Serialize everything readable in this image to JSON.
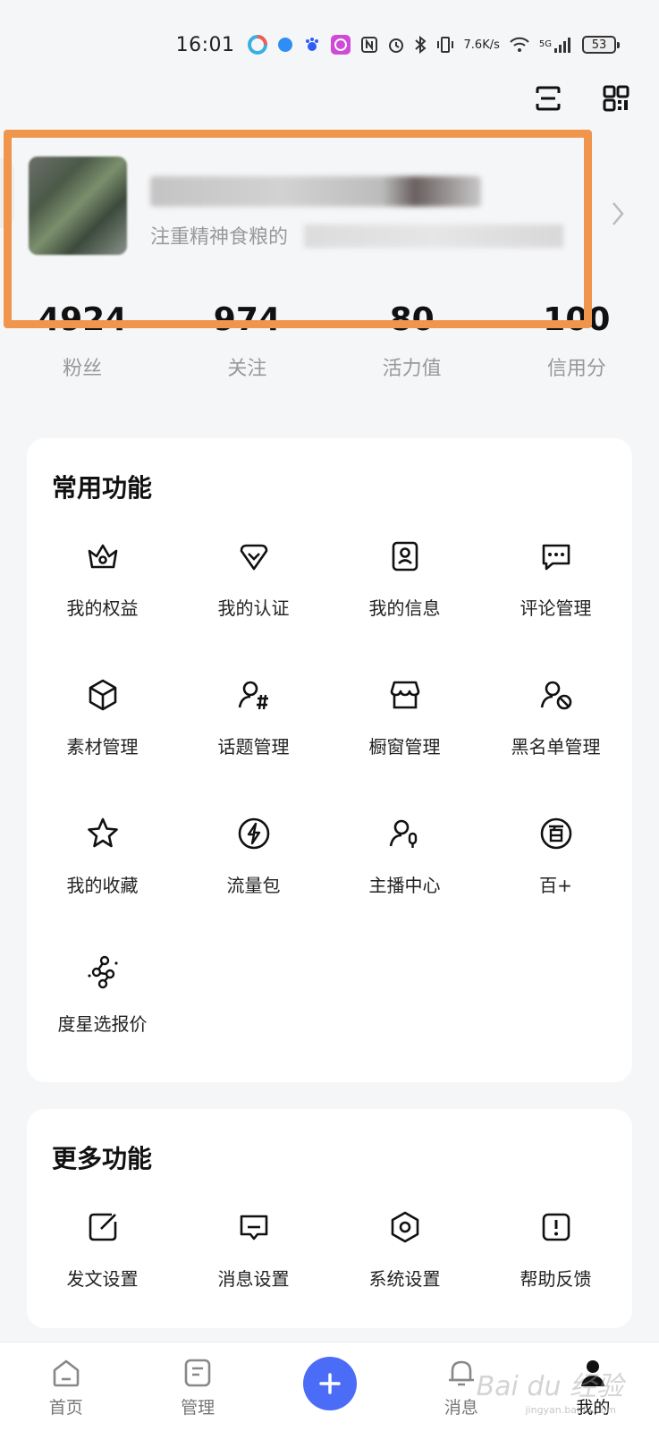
{
  "status_bar": {
    "time": "16:01",
    "network_speed_value": "7.6",
    "network_speed_unit": "K/s",
    "signal": "5G",
    "battery": "53"
  },
  "profile": {
    "bio": "注重精神食粮的"
  },
  "stats": [
    {
      "value": "4924",
      "label": "粉丝"
    },
    {
      "value": "974",
      "label": "关注"
    },
    {
      "value": "80",
      "label": "活力值"
    },
    {
      "value": "100",
      "label": "信用分"
    }
  ],
  "common_functions": {
    "title": "常用功能",
    "items": [
      {
        "label": "我的权益",
        "icon": "crown-icon"
      },
      {
        "label": "我的认证",
        "icon": "verify-badge-icon"
      },
      {
        "label": "我的信息",
        "icon": "profile-card-icon"
      },
      {
        "label": "评论管理",
        "icon": "comment-icon"
      },
      {
        "label": "素材管理",
        "icon": "cube-icon"
      },
      {
        "label": "话题管理",
        "icon": "topic-icon"
      },
      {
        "label": "橱窗管理",
        "icon": "shop-icon"
      },
      {
        "label": "黑名单管理",
        "icon": "block-user-icon"
      },
      {
        "label": "我的收藏",
        "icon": "star-icon"
      },
      {
        "label": "流量包",
        "icon": "lightning-icon"
      },
      {
        "label": "主播中心",
        "icon": "anchor-mic-icon"
      },
      {
        "label": "百+",
        "icon": "bai-plus-icon"
      },
      {
        "label": "度星选报价",
        "icon": "star-select-icon"
      }
    ]
  },
  "more_functions": {
    "title": "更多功能",
    "items": [
      {
        "label": "发文设置",
        "icon": "edit-icon"
      },
      {
        "label": "消息设置",
        "icon": "message-icon"
      },
      {
        "label": "系统设置",
        "icon": "settings-hex-icon"
      },
      {
        "label": "帮助反馈",
        "icon": "help-icon"
      }
    ]
  },
  "bottom_nav": [
    {
      "label": "首页",
      "icon": "home-icon"
    },
    {
      "label": "管理",
      "icon": "manage-icon"
    },
    {
      "label": "",
      "icon": "plus-icon"
    },
    {
      "label": "消息",
      "icon": "bell-icon"
    },
    {
      "label": "我的",
      "icon": "user-icon"
    }
  ],
  "colors": {
    "highlight": "#f0954c",
    "accent": "#4a6cf7",
    "background": "#f5f6f8"
  },
  "watermark": {
    "text": "Bai du 经验",
    "sub": "jingyan.baidu.com"
  }
}
